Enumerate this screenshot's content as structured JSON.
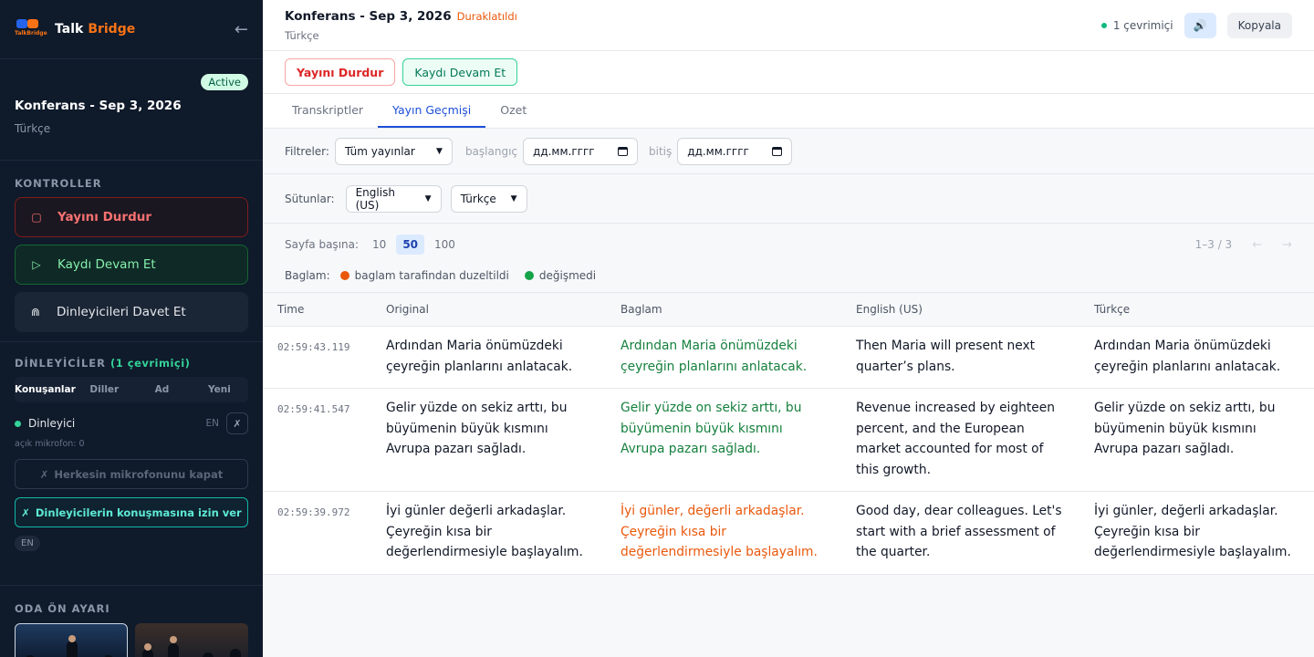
{
  "brand": {
    "name_part1": "Talk",
    "name_part2": "Bridge",
    "logo_text": "TalkBridge"
  },
  "session": {
    "status_badge": "Active",
    "title": "Konferans - Sep 3, 2026",
    "language": "Türkçe"
  },
  "controls": {
    "section_title": "KONTROLLER",
    "stop_label": "Yayını Durdur",
    "resume_label": "Kaydı Devam Et",
    "invite_label": "Dinleyicileri Davet Et"
  },
  "listeners": {
    "section_title": "DİNLEYİCİLER",
    "online_count": "(1 çevrimiçi)",
    "tabs": [
      "Konuşanlar",
      "Diller",
      "Ad",
      "Yeni"
    ],
    "items": [
      {
        "name": "Dinleyici",
        "lang": "EN"
      }
    ],
    "open_mic_text": "açık mikrofon: 0",
    "mute_all_label": "Herkesin mikrofonunu kapat",
    "allow_speak_label": "Dinleyicilerin konuşmasına izin ver",
    "lang_chip": "EN"
  },
  "preset": {
    "section_title": "ODA ÖN AYARI"
  },
  "topbar": {
    "title": "Konferans - Sep 3, 2026",
    "status": "Duraklatıldı",
    "language": "Türkçe",
    "online": "1 çevrimiçi",
    "copy_label": "Kopyala"
  },
  "actions": {
    "stop_label": "Yayını Durdur",
    "resume_label": "Kaydı Devam Et"
  },
  "tabs": [
    {
      "label": "Transkriptler"
    },
    {
      "label": "Yayın Geçmişi"
    },
    {
      "label": "Ozet"
    }
  ],
  "filters": {
    "label": "Filtreler:",
    "type_value": "Tüm yayınlar",
    "start_label": "başlangıç",
    "start_value": "дд.мм.гггг",
    "end_label": "bitiş",
    "end_value": "дд.мм.гггг"
  },
  "columns_select": {
    "label": "Sütunlar:",
    "first": "English (US)",
    "second": "Türkçe"
  },
  "pager": {
    "label": "Sayfa başına:",
    "options": [
      "10",
      "50",
      "100"
    ],
    "selected": "50",
    "info": "1–3 / 3",
    "prev": "←",
    "next": "→"
  },
  "legend": {
    "label": "Baglam:",
    "edited": "baglam tarafindan duzeltildi",
    "unchanged": "değişmedi",
    "edited_color": "#ea580c",
    "unchanged_color": "#16a34a"
  },
  "table": {
    "headers": [
      "Time",
      "Original",
      "Baglam",
      "English (US)",
      "Türkçe"
    ],
    "rows": [
      {
        "time": "02:59:43.119",
        "original": "Ardından Maria önümüzdeki çeyreğin planlarını anlatacak.",
        "baglam": "Ardından Maria önümüzdeki çeyreğin planlarını anlatacak.",
        "english": "Then Maria will present next quarter’s plans.",
        "turkish": "Ardından Maria önümüzdeki çeyreğin planlarını anlatacak."
      },
      {
        "time": "02:59:41.547",
        "original": "Gelir yüzde on sekiz arttı, bu büyümenin büyük kısmını Avrupa pazarı sağladı.",
        "baglam": "Gelir yüzde on sekiz arttı, bu büyümenin büyük kısmını Avrupa pazarı sağladı.",
        "english": "Revenue increased by eighteen percent, and the European market accounted for most of this growth.",
        "turkish": "Gelir yüzde on sekiz arttı, bu büyümenin büyük kısmını Avrupa pazarı sağladı."
      },
      {
        "time": "02:59:39.972",
        "original": "İyi günler değerli arkadaşlar. Çeyreğin kısa bir değerlendirmesiyle başlayalım.",
        "baglam": "İyi günler, değerli arkadaşlar. Çeyreğin kısa bir değerlendirmesiyle başlayalım.",
        "english": "Good day, dear colleagues. Let's start with a brief assessment of the quarter.",
        "turkish": "İyi günler, değerli arkadaşlar. Çeyreğin kısa bir değerlendirmesiyle başlayalım."
      }
    ]
  }
}
